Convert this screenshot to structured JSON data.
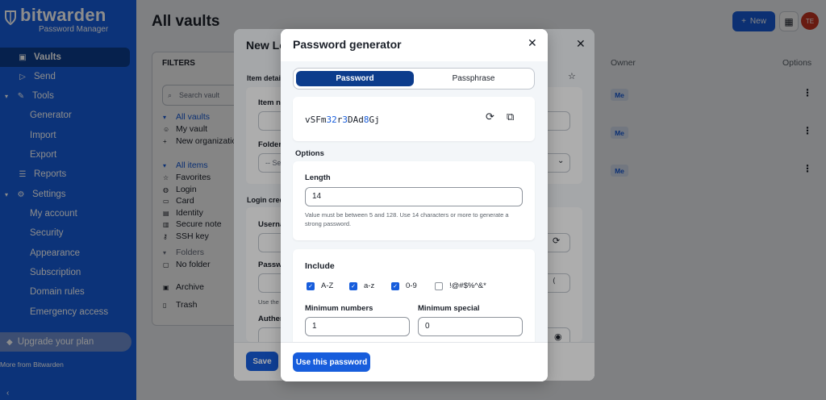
{
  "app": {
    "brand": "bitwarden",
    "subtitle": "Password Manager"
  },
  "sidebar": {
    "items": [
      {
        "label": "Vaults",
        "icon": "vault-icon",
        "active": true
      },
      {
        "label": "Send",
        "icon": "send-icon"
      },
      {
        "label": "Tools",
        "icon": "tools-icon",
        "expandable": true
      },
      {
        "label": "Generator"
      },
      {
        "label": "Import"
      },
      {
        "label": "Export"
      },
      {
        "label": "Reports",
        "icon": "reports-icon"
      },
      {
        "label": "Settings",
        "icon": "gear-icon",
        "expandable": true
      },
      {
        "label": "My account"
      },
      {
        "label": "Security"
      },
      {
        "label": "Appearance"
      },
      {
        "label": "Subscription"
      },
      {
        "label": "Domain rules"
      },
      {
        "label": "Emergency access"
      }
    ],
    "upgrade": "Upgrade your plan",
    "more": "More from Bitwarden"
  },
  "main": {
    "title": "All vaults",
    "new_label": "New",
    "avatar_initials": "TE",
    "filters": {
      "title": "FILTERS",
      "search_placeholder": "Search vault",
      "vaults": [
        "All vaults",
        "My vault",
        "New organization"
      ],
      "types_header": "All items",
      "types": [
        "Favorites",
        "Login",
        "Card",
        "Identity",
        "Secure note",
        "SSH key"
      ],
      "folders_header": "Folders",
      "folders": [
        "No folder"
      ],
      "archive": "Archive",
      "trash": "Trash"
    },
    "table": {
      "owner_header": "Owner",
      "options_header": "Options",
      "rows": [
        {
          "owner": "Me"
        },
        {
          "owner": "Me"
        },
        {
          "owner": "Me"
        }
      ]
    }
  },
  "back_dialog": {
    "title": "New Lo",
    "item_details": "Item detai",
    "item_name": "Item na",
    "folder": "Folder",
    "folder_value": "-- Se",
    "login_credentials": "Login cred",
    "username": "Userna",
    "password": "Passw",
    "use_the": "Use the",
    "authenticator": "Authen",
    "save_label": "Save"
  },
  "generator": {
    "title": "Password generator",
    "tabs": {
      "password": "Password",
      "passphrase": "Passphrase"
    },
    "password_parts": [
      {
        "text": "vSFm",
        "num": false
      },
      {
        "text": "32",
        "num": true
      },
      {
        "text": "r",
        "num": false
      },
      {
        "text": "3",
        "num": true
      },
      {
        "text": "DAd",
        "num": false
      },
      {
        "text": "8",
        "num": true
      },
      {
        "text": "Gj",
        "num": false
      }
    ],
    "options_label": "Options",
    "length_label": "Length",
    "length_value": "14",
    "length_hint": "Value must be between 5 and 128. Use 14 characters or more to generate a strong password.",
    "include_label": "Include",
    "include": [
      {
        "label": "A-Z",
        "checked": true
      },
      {
        "label": "a-z",
        "checked": true
      },
      {
        "label": "0-9",
        "checked": true
      },
      {
        "label": "!@#$%^&*",
        "checked": false
      }
    ],
    "min_numbers_label": "Minimum numbers",
    "min_numbers_value": "1",
    "min_special_label": "Minimum special",
    "min_special_value": "0",
    "use_button": "Use this password"
  }
}
